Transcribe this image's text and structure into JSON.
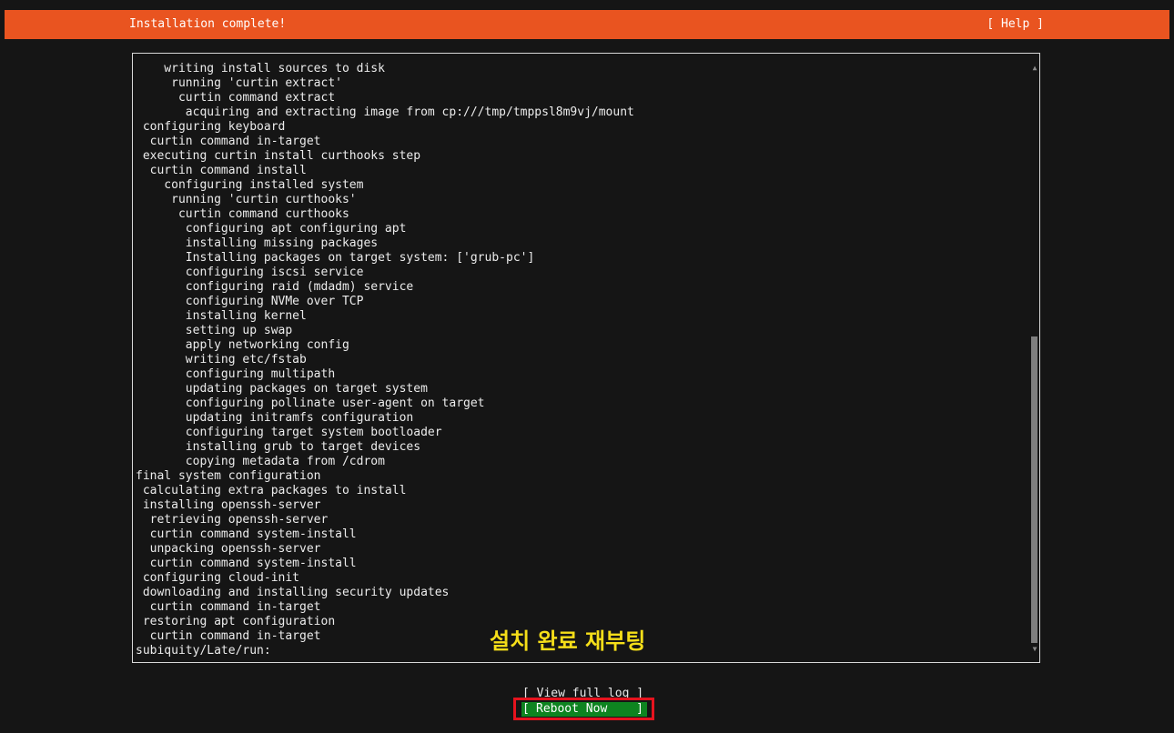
{
  "header": {
    "title": "Installation complete!",
    "help_label": "[ Help ]"
  },
  "log": {
    "lines": [
      "    writing install sources to disk",
      "     running 'curtin extract'",
      "      curtin command extract",
      "       acquiring and extracting image from cp:///tmp/tmppsl8m9vj/mount",
      " configuring keyboard",
      "  curtin command in-target",
      " executing curtin install curthooks step",
      "  curtin command install",
      "    configuring installed system",
      "     running 'curtin curthooks'",
      "      curtin command curthooks",
      "       configuring apt configuring apt",
      "       installing missing packages",
      "       Installing packages on target system: ['grub-pc']",
      "       configuring iscsi service",
      "       configuring raid (mdadm) service",
      "       configuring NVMe over TCP",
      "       installing kernel",
      "       setting up swap",
      "       apply networking config",
      "       writing etc/fstab",
      "       configuring multipath",
      "       updating packages on target system",
      "       configuring pollinate user-agent on target",
      "       updating initramfs configuration",
      "       configuring target system bootloader",
      "       installing grub to target devices",
      "       copying metadata from /cdrom",
      "final system configuration",
      " calculating extra packages to install",
      " installing openssh-server",
      "  retrieving openssh-server",
      "  curtin command system-install",
      "  unpacking openssh-server",
      "  curtin command system-install",
      " configuring cloud-init",
      " downloading and installing security updates",
      "  curtin command in-target",
      " restoring apt configuration",
      "  curtin command in-target",
      "subiquity/Late/run:"
    ]
  },
  "scrollbar": {
    "up_icon": "▲",
    "down_icon": "▼"
  },
  "annotation": {
    "text": "설치 완료 재부팅",
    "color": "#f5de19"
  },
  "buttons": {
    "view_log": "[ View full log ]",
    "reboot_open": "[",
    "reboot_label": "Reboot Now",
    "reboot_close": "]"
  },
  "colors": {
    "header_bg": "#e95420",
    "button_bg": "#0e8420",
    "highlight_border": "#e6131e",
    "background": "#151515"
  }
}
